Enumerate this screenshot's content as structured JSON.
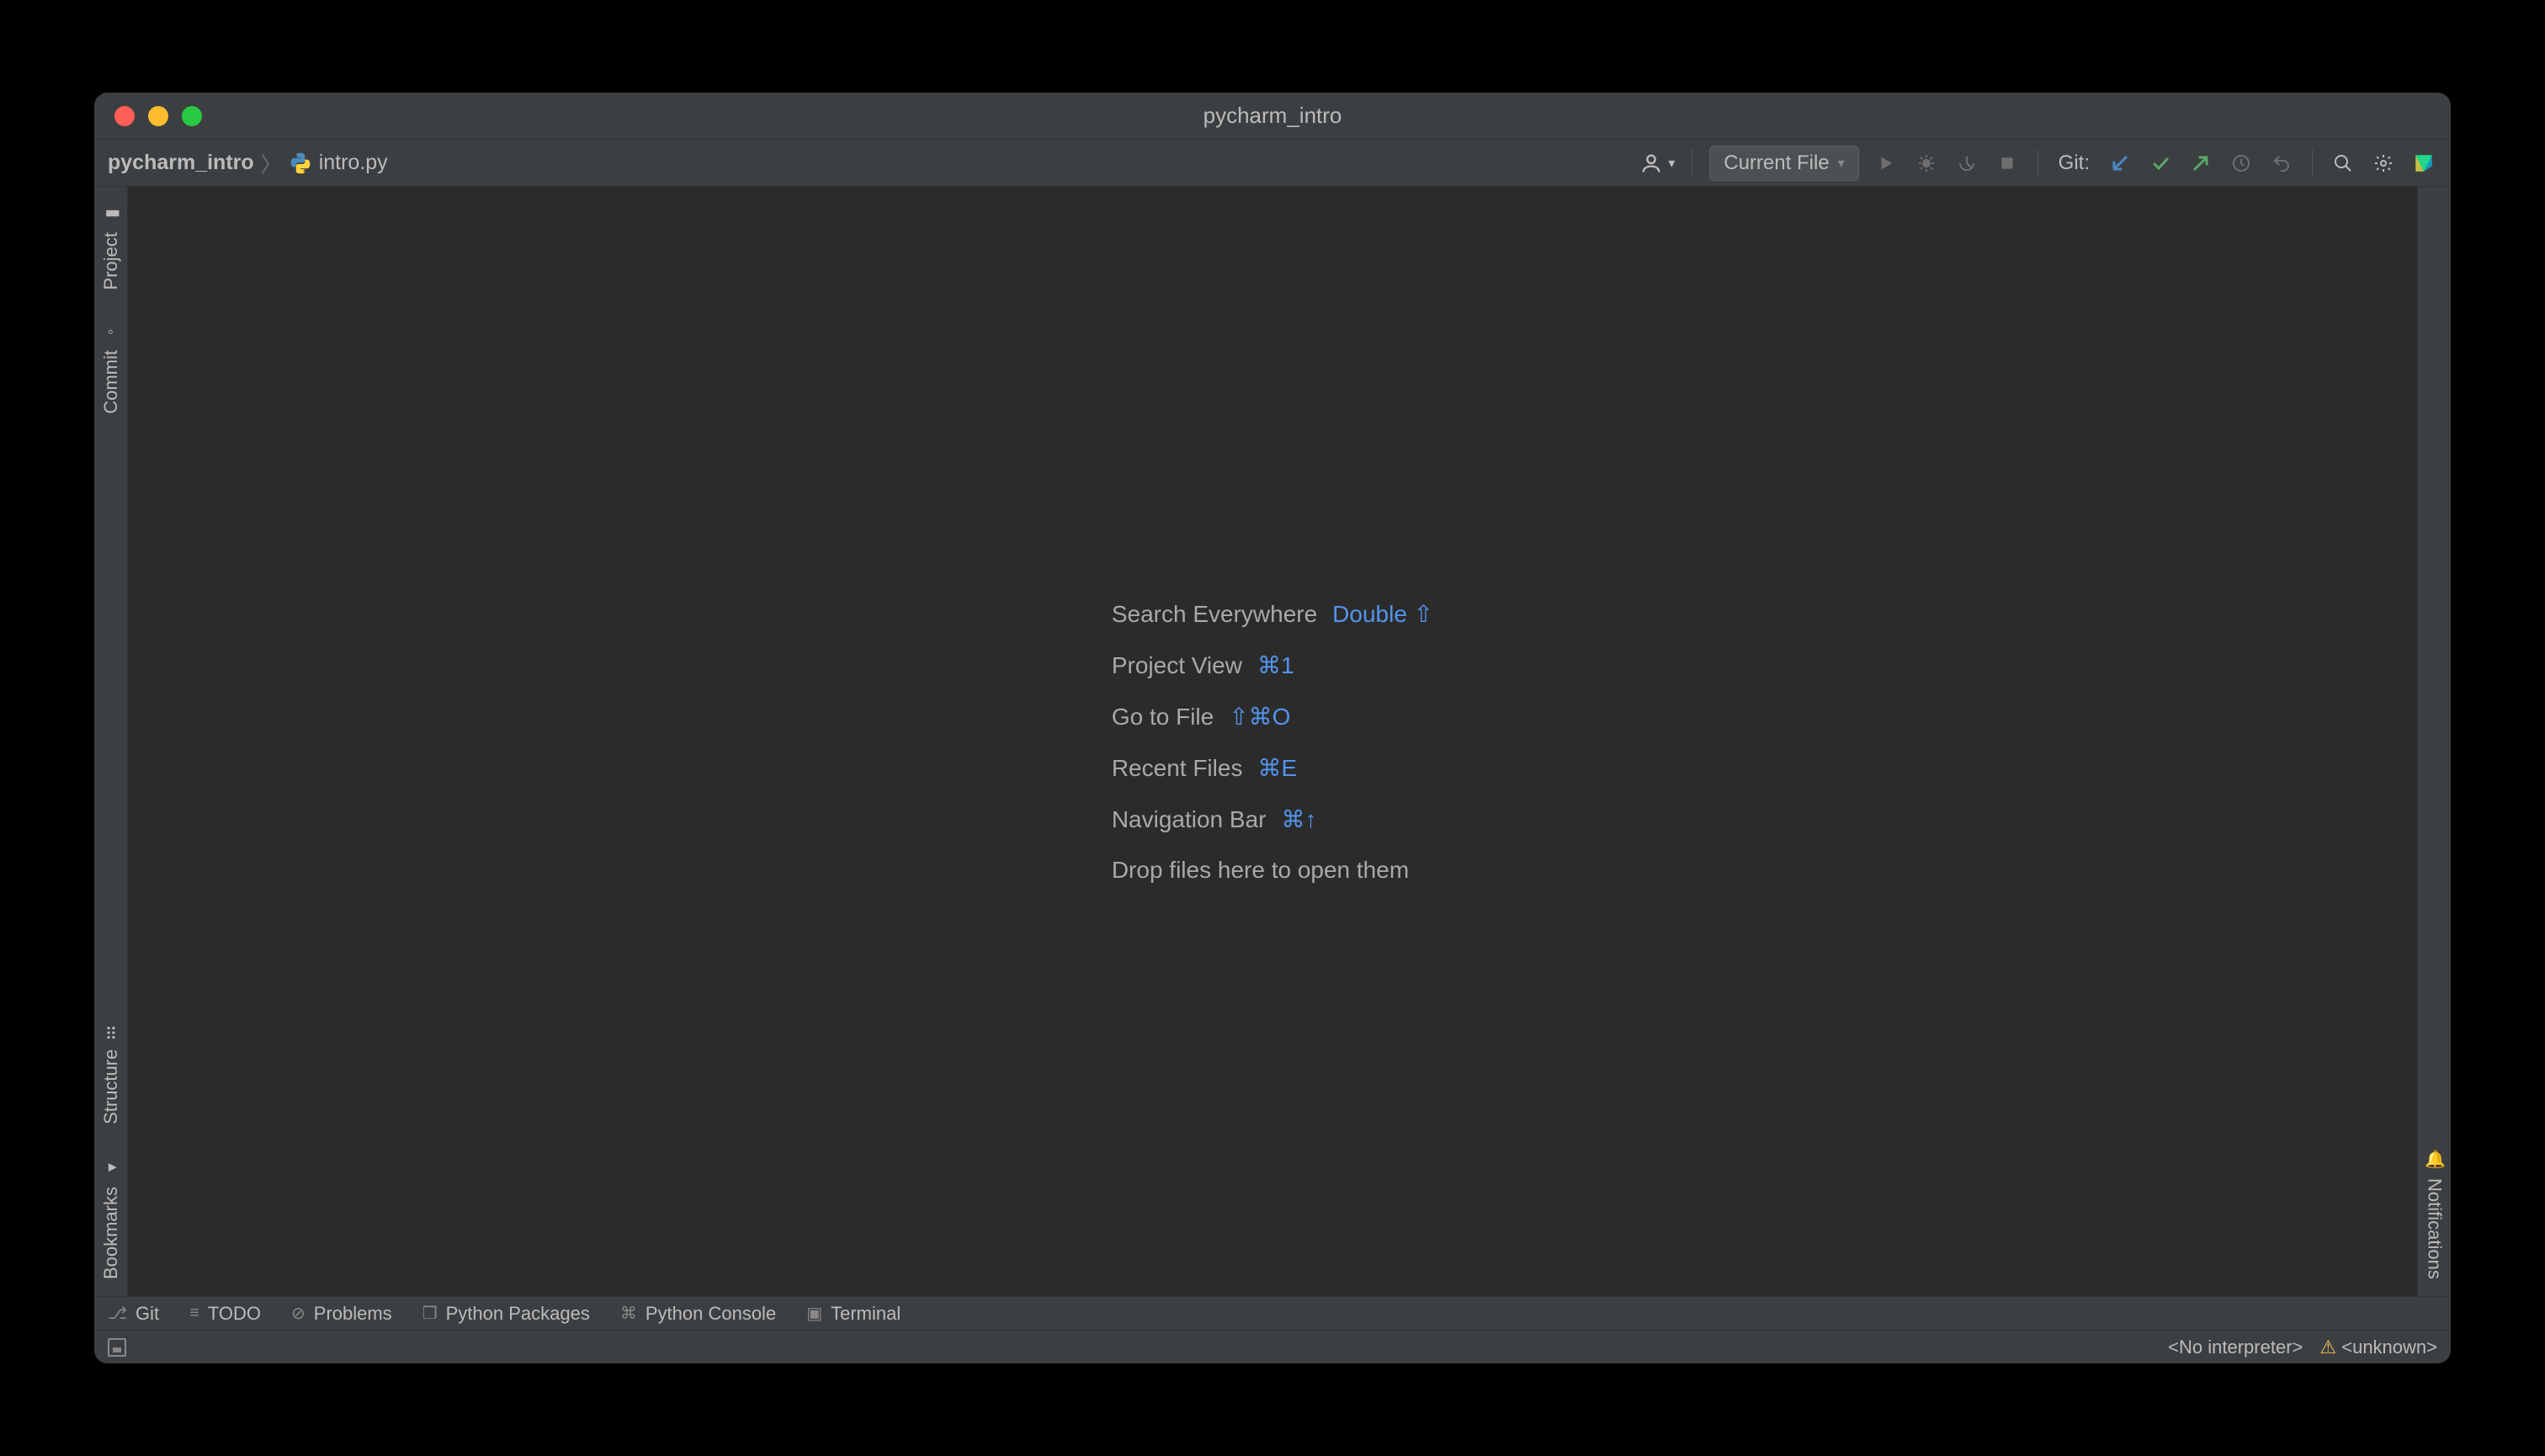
{
  "window": {
    "title": "pycharm_intro"
  },
  "breadcrumb": {
    "project": "pycharm_intro",
    "file": "intro.py"
  },
  "toolbar": {
    "run_config": "Current File",
    "git_label": "Git:"
  },
  "gutter": {
    "left_top": [
      {
        "label": "Project"
      },
      {
        "label": "Commit"
      }
    ],
    "left_bottom": [
      {
        "label": "Structure"
      },
      {
        "label": "Bookmarks"
      }
    ],
    "right": [
      {
        "label": "Notifications"
      }
    ]
  },
  "tips": {
    "rows": [
      {
        "label": "Search Everywhere",
        "shortcut": "Double ⇧"
      },
      {
        "label": "Project View",
        "shortcut": "⌘1"
      },
      {
        "label": "Go to File",
        "shortcut": "⇧⌘O"
      },
      {
        "label": "Recent Files",
        "shortcut": "⌘E"
      },
      {
        "label": "Navigation Bar",
        "shortcut": "⌘↑"
      }
    ],
    "drop_hint": "Drop files here to open them"
  },
  "bottom": {
    "items": [
      {
        "label": "Git"
      },
      {
        "label": "TODO"
      },
      {
        "label": "Problems"
      },
      {
        "label": "Python Packages"
      },
      {
        "label": "Python Console"
      },
      {
        "label": "Terminal"
      }
    ]
  },
  "status": {
    "interpreter": "<No interpreter>",
    "unknown": "<unknown>"
  }
}
